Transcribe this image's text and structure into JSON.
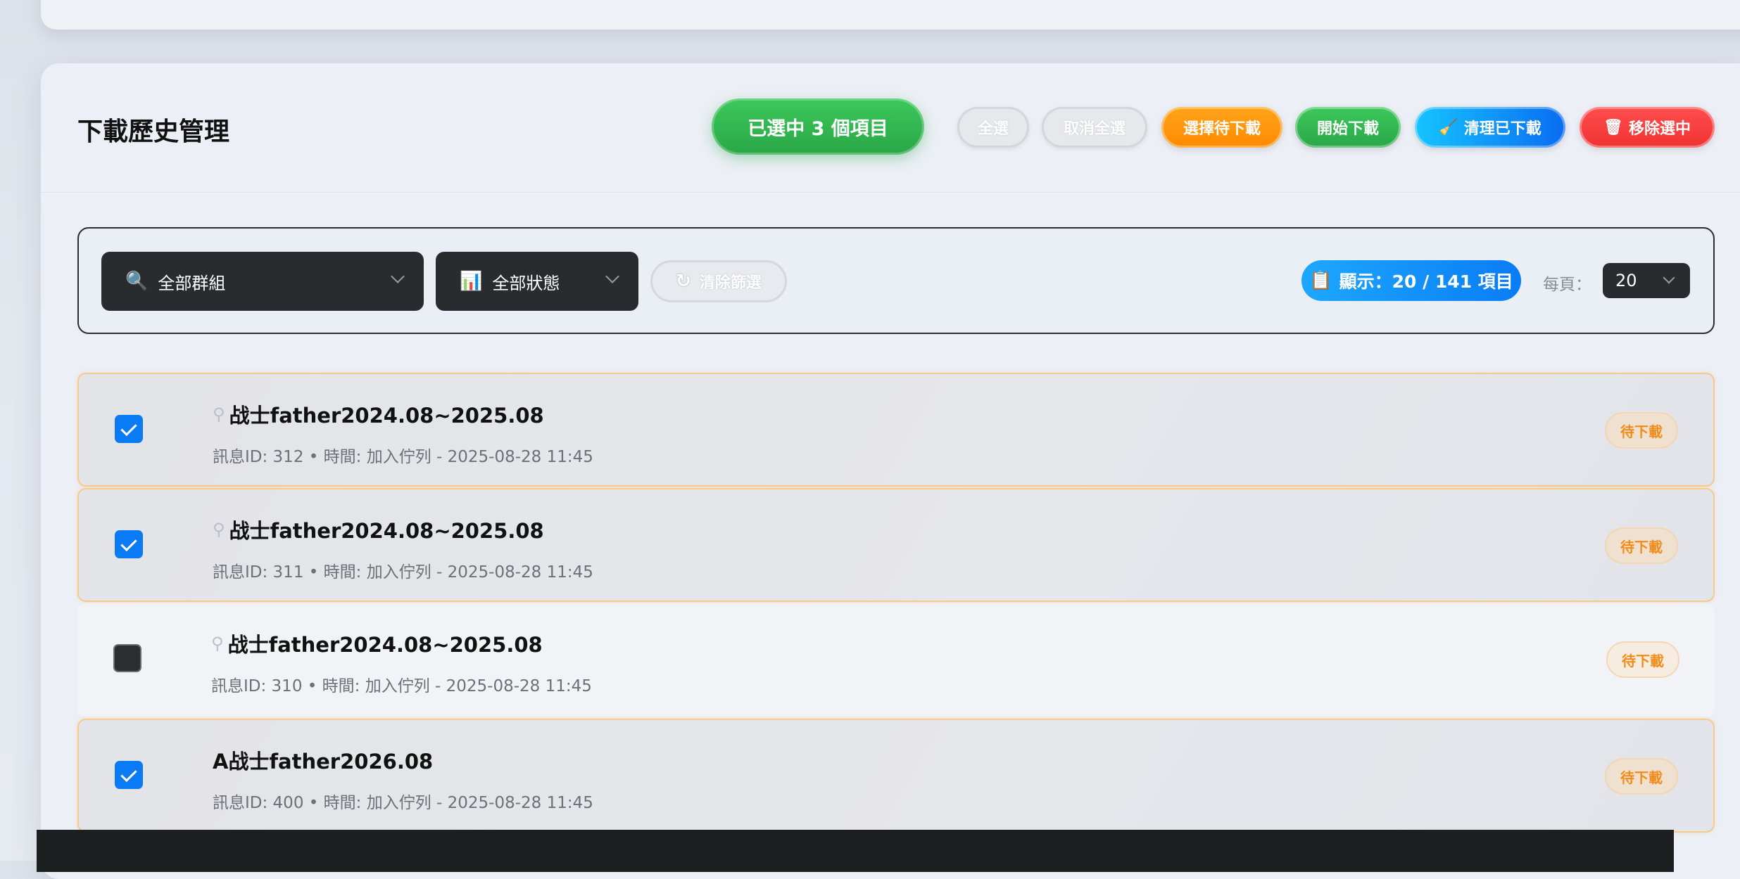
{
  "header": {
    "title": "下載歷史管理",
    "selected_count_label": "已選中 3 個項目",
    "buttons": {
      "select_all": "全選",
      "deselect_all": "取消全選",
      "select_pending": "選擇待下載",
      "start_download": "開始下載",
      "clear_downloaded": "清理已下載",
      "clear_downloaded_icon": "broom-icon",
      "remove_selected": "移除選中",
      "remove_selected_icon": "trash-icon"
    }
  },
  "filters": {
    "group_select": {
      "icon": "search-icon",
      "value": "全部群組"
    },
    "status_select": {
      "icon": "bar-chart-icon",
      "value": "全部狀態"
    },
    "clear_filter": {
      "icon": "reset-icon",
      "label": "清除篩選"
    },
    "count": {
      "icon": "clipboard-icon",
      "label": "顯示：20 / 141 項目"
    },
    "per_page_label": "每頁：",
    "per_page_value": "20"
  },
  "items": [
    {
      "selected": true,
      "icon": "magnifier-icon",
      "title": "战士father2024.08~2025.08",
      "meta": "訊息ID: 312 • 時間: 加入佇列 - 2025-08-28 11:45",
      "status": "待下載"
    },
    {
      "selected": true,
      "icon": "magnifier-icon",
      "title": "战士father2024.08~2025.08",
      "meta": "訊息ID: 311 • 時間: 加入佇列 - 2025-08-28 11:45",
      "status": "待下載"
    },
    {
      "selected": false,
      "icon": "magnifier-icon",
      "title": "战士father2024.08~2025.08",
      "meta": "訊息ID: 310 • 時間: 加入佇列 - 2025-08-28 11:45",
      "status": "待下載"
    },
    {
      "selected": true,
      "icon": "",
      "title": "A战士father2026.08",
      "meta": "訊息ID: 400 • 時間: 加入佇列 - 2025-08-28 11:45",
      "status": "待下載"
    }
  ],
  "colors": {
    "accent_blue": "#0b7bf5",
    "success_green": "#2aa747",
    "warning_orange": "#ff8a00",
    "danger_red": "#f03232"
  }
}
